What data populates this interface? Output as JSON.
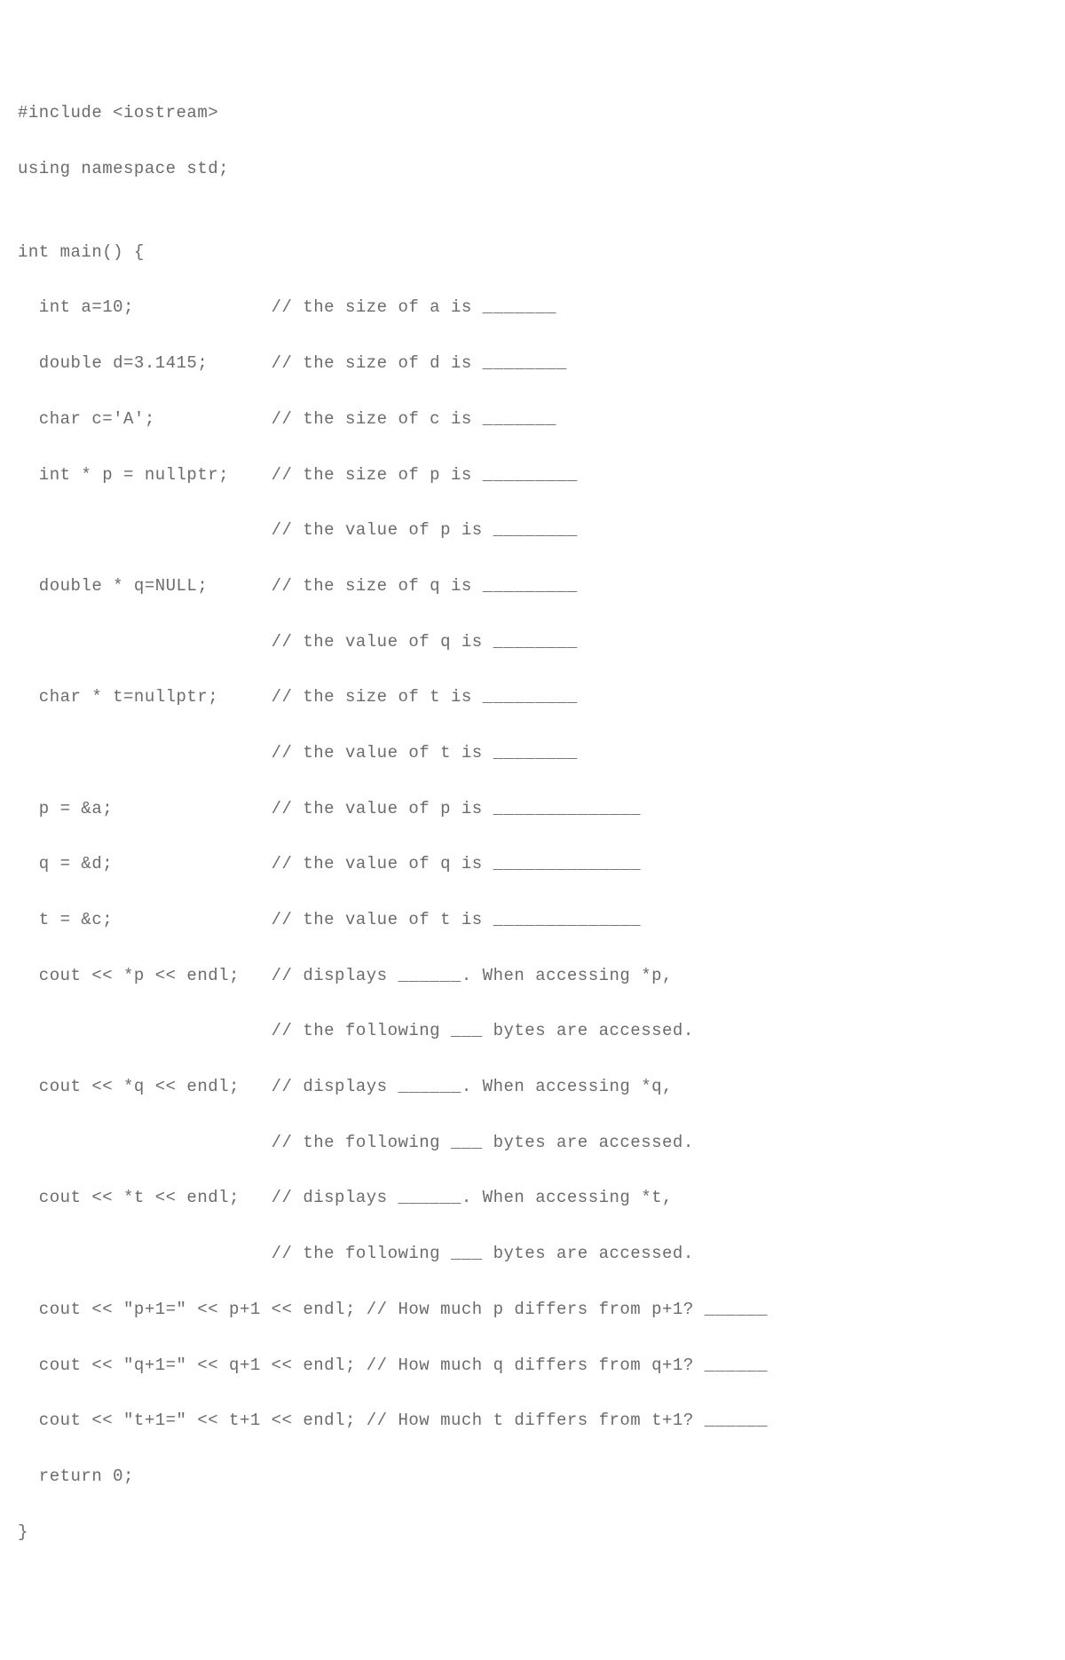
{
  "code": {
    "l01": "#include <iostream>",
    "l02": "using namespace std;",
    "l03": "",
    "l04": "int main() {",
    "l05": "  int a=10;             // the size of a is _______",
    "l06": "  double d=3.1415;      // the size of d is ________",
    "l07": "  char c='A';           // the size of c is _______",
    "l08": "  int * p = nullptr;    // the size of p is _________",
    "l09": "                        // the value of p is ________",
    "l10": "  double * q=NULL;      // the size of q is _________",
    "l11": "                        // the value of q is ________",
    "l12": "  char * t=nullptr;     // the size of t is _________",
    "l13": "                        // the value of t is ________",
    "l14": "  p = &a;               // the value of p is ______________",
    "l15": "  q = &d;               // the value of q is ______________",
    "l16": "  t = &c;               // the value of t is ______________",
    "l17": "  cout << *p << endl;   // displays ______. When accessing *p,",
    "l18": "                        // the following ___ bytes are accessed.",
    "l19": "  cout << *q << endl;   // displays ______. When accessing *q,",
    "l20": "                        // the following ___ bytes are accessed.",
    "l21": "  cout << *t << endl;   // displays ______. When accessing *t,",
    "l22": "                        // the following ___ bytes are accessed.",
    "l23": "  cout << \"p+1=\" << p+1 << endl; // How much p differs from p+1? ______",
    "l24": "  cout << \"q+1=\" << q+1 << endl; // How much q differs from q+1? ______",
    "l25": "  cout << \"t+1=\" << t+1 << endl; // How much t differs from t+1? ______",
    "l26": "  return 0;",
    "l27": "}"
  }
}
